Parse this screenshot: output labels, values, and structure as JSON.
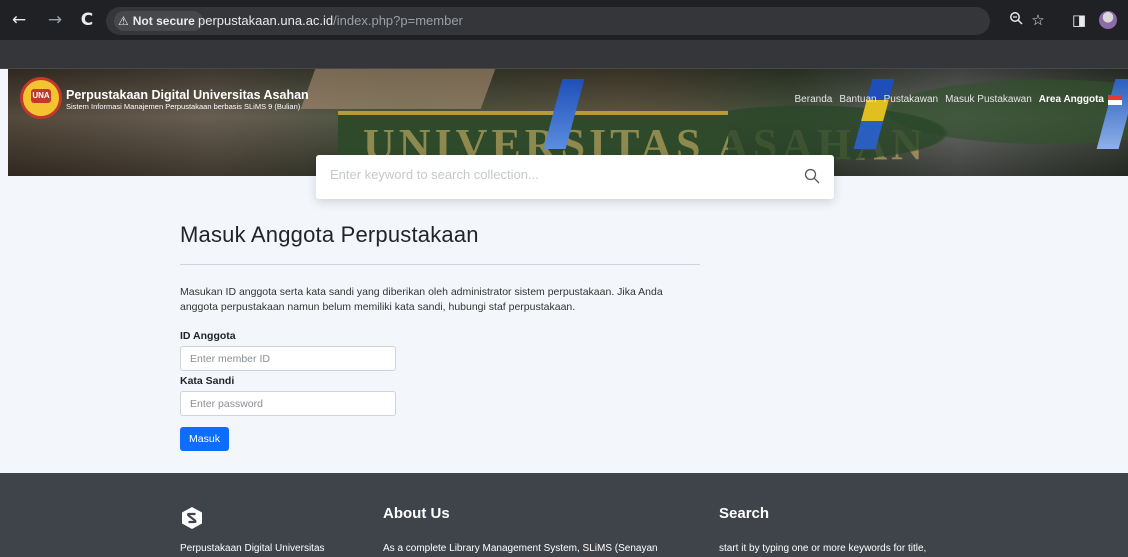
{
  "browser": {
    "back_icon": "←",
    "forward_icon": "→",
    "reload_icon": "C",
    "security_label": "Not secure",
    "url_host": "perpustakaan.una.ac.id",
    "url_path": "/index.php?p=member",
    "zoom_icon": "🔍",
    "star_icon": "☆",
    "sidepanel_icon": "◨"
  },
  "site": {
    "title": "Perpustakaan Digital Universitas Asahan",
    "subtitle": "Sistem Informasi Manajemen Perpustakaan berbasis SLiMS 9 (Bulian)",
    "logo_text": "UNA",
    "banner_text": "UNIVERSITAS ASAHAN",
    "nav": [
      "Beranda",
      "Bantuan",
      "Pustakawan",
      "Masuk Pustakawan",
      "Area Anggota"
    ],
    "nav_active": "Area Anggota"
  },
  "search": {
    "placeholder": "Enter keyword to search collection..."
  },
  "login": {
    "title": "Masuk Anggota Perpustakaan",
    "intro": "Masukan ID anggota serta kata sandi yang diberikan oleh administrator sistem perpustakaan. Jika Anda anggota perpustakaan namun belum memiliki kata sandi, hubungi staf perpustakaan.",
    "id_label": "ID Anggota",
    "id_placeholder": "Enter member ID",
    "password_label": "Kata Sandi",
    "password_placeholder": "Enter password",
    "submit_label": "Masuk"
  },
  "footer": {
    "brand": "Perpustakaan Digital Universitas",
    "about_heading": "About Us",
    "about_text": "As a complete Library Management System, SLiMS (Senayan",
    "search_heading": "Search",
    "search_text": "start it by typing one or more keywords for title,"
  },
  "colors": {
    "accent": "#0d6efd",
    "footer_bg": "#3f434a",
    "page_bg": "#f3f6fb"
  }
}
